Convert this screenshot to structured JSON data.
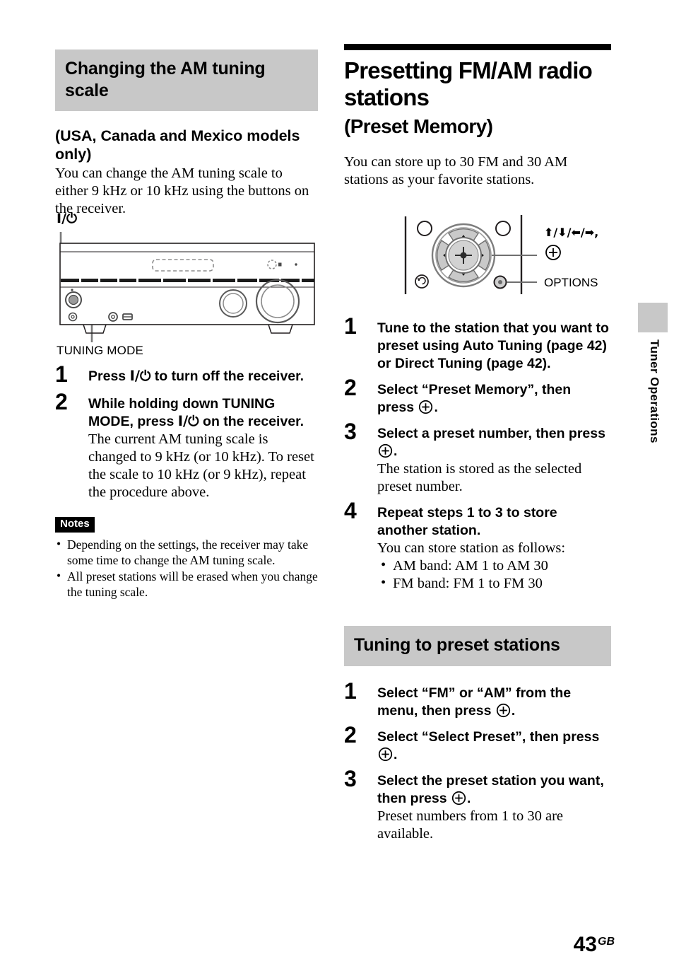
{
  "left_column": {
    "heading": "Changing the AM tuning scale",
    "subheading": "(USA, Canada and Mexico models only)",
    "intro": "You can change the AM tuning scale to either 9 kHz or 10 kHz using the buttons on the receiver.",
    "figure": {
      "power_label": "I/⏻",
      "tuning_mode_label": "TUNING MODE"
    },
    "steps": [
      {
        "number": "1",
        "title_before": "Press ",
        "title_glyph": "I/⏻",
        "title_after": " to turn off the receiver."
      },
      {
        "number": "2",
        "title_before": "While holding down TUNING MODE, press ",
        "title_glyph": "I/⏻",
        "title_after": " on the receiver.",
        "desc": "The current AM tuning scale is changed to 9 kHz (or 10 kHz). To reset the scale to 10 kHz (or 9 kHz), repeat the procedure above."
      }
    ],
    "notes": {
      "badge": "Notes",
      "items": [
        "Depending on the settings, the receiver may take some time to change the AM tuning scale.",
        "All preset stations will be erased when you change the tuning scale."
      ]
    }
  },
  "right_column": {
    "chapter_title": "Presetting FM/AM radio stations",
    "chapter_subtitle": "(Preset Memory)",
    "intro": "You can store up to 30 FM and 30 AM stations as your favorite stations.",
    "figure": {
      "callout_arrows": "⬆/⬇/⬅/➡,",
      "callout_enter": "enter-icon",
      "callout_options": "OPTIONS"
    },
    "steps": [
      {
        "number": "1",
        "title": "Tune to the station that you want to preset using Auto Tuning (page 42) or Direct Tuning (page 42)."
      },
      {
        "number": "2",
        "title_before": "Select “Preset Memory”, then press ",
        "title_after": "."
      },
      {
        "number": "3",
        "title_before": "Select a preset number, then press ",
        "title_after": ".",
        "desc": "The station is stored as the selected preset number."
      },
      {
        "number": "4",
        "title": "Repeat steps 1 to 3 to store another station.",
        "desc": "You can store station as follows:",
        "bullets": [
          "AM band: AM 1 to AM 30",
          "FM band: FM 1 to FM 30"
        ]
      }
    ],
    "section2": {
      "heading": "Tuning to preset stations",
      "steps": [
        {
          "number": "1",
          "title_before": "Select “FM” or “AM” from the menu, then press ",
          "title_after": "."
        },
        {
          "number": "2",
          "title_before": "Select “Select Preset”, then press ",
          "title_after": "."
        },
        {
          "number": "3",
          "title_before": "Select the preset station you want, then press ",
          "title_after": ".",
          "desc": "Preset numbers from 1 to 30 are available."
        }
      ]
    }
  },
  "side_tab": {
    "label": "Tuner Operations"
  },
  "page": {
    "number": "43",
    "region": "GB"
  },
  "colors": {
    "heading_background": "#c8c8c8",
    "text": "#000000",
    "badge_background": "#000000"
  }
}
